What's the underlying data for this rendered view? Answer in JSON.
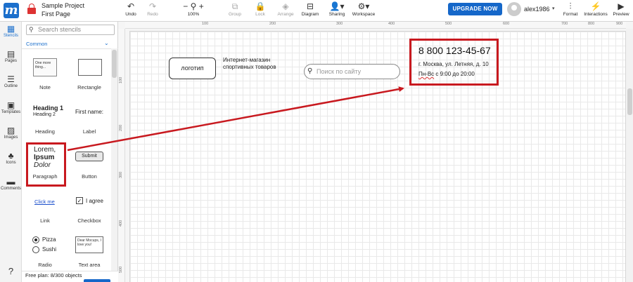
{
  "header": {
    "project_name": "Sample Project",
    "page_name": "First Page",
    "tools": [
      {
        "label": "Undo",
        "icon": "undo-icon"
      },
      {
        "label": "Redo",
        "icon": "redo-icon"
      },
      {
        "label": "100%",
        "icon": "zoom-icon"
      },
      {
        "label": "Group",
        "icon": "group-icon"
      },
      {
        "label": "Lock",
        "icon": "lock-icon"
      },
      {
        "label": "Arrange",
        "icon": "arrange-icon"
      },
      {
        "label": "Diagram",
        "icon": "diagram-icon"
      },
      {
        "label": "Sharing",
        "icon": "sharing-icon"
      },
      {
        "label": "Workspace",
        "icon": "workspace-icon"
      }
    ],
    "upgrade_label": "UPGRADE NOW",
    "username": "alex1986",
    "right_tools": [
      {
        "label": "Format",
        "icon": "format-icon"
      },
      {
        "label": "Interactions",
        "icon": "interactions-icon"
      },
      {
        "label": "Preview",
        "icon": "preview-icon"
      }
    ]
  },
  "rail": {
    "items": [
      {
        "label": "Stencils",
        "icon": "stencils-icon"
      },
      {
        "label": "Pages",
        "icon": "pages-icon"
      },
      {
        "label": "Outline",
        "icon": "outline-icon"
      },
      {
        "label": "Templates",
        "icon": "templates-icon"
      },
      {
        "label": "Images",
        "icon": "images-icon"
      },
      {
        "label": "Icons",
        "icon": "icons-icon"
      },
      {
        "label": "Comments",
        "icon": "comments-icon"
      }
    ],
    "help_icon": "help-icon"
  },
  "panel": {
    "search_placeholder": "Search stencils",
    "section": "Common",
    "tiles": [
      {
        "label": "Note",
        "preview": "One more thing..."
      },
      {
        "label": "Rectangle",
        "preview": ""
      },
      {
        "label": "Heading",
        "preview": "Heading 1",
        "preview2": "Heading 2"
      },
      {
        "label": "Label",
        "preview": "First name:"
      },
      {
        "label": "Paragraph",
        "preview": "Lorem,",
        "preview2": "Ipsum",
        "preview3": "Dolor"
      },
      {
        "label": "Button",
        "preview": "Submit"
      },
      {
        "label": "Link",
        "preview": "Click me"
      },
      {
        "label": "Checkbox",
        "preview": "I agree"
      },
      {
        "label": "Radio",
        "preview": "Pizza",
        "preview2": "Sushi"
      },
      {
        "label": "Text area",
        "preview": "Dear Mocups, I love you!"
      }
    ],
    "free_plan": "Free plan: 8/300 objects"
  },
  "canvas": {
    "h_ruler": [
      "100",
      "200",
      "300",
      "400",
      "500",
      "600",
      "700",
      "800",
      "900"
    ],
    "v_ruler": [
      "100",
      "200",
      "300",
      "400",
      "500",
      "600"
    ],
    "logo_text": "логотип",
    "shop_line1": "Интернет-магазин",
    "shop_line2": "спортивных товаров",
    "search_placeholder": "Поиск по сайту",
    "phone": "8 800 123-45-67",
    "address": "г. Москва, ул. Летняя, д. 10",
    "hours_prefix": "Пн-Вс",
    "hours_rest": " с 9:00 до 20:00"
  },
  "colors": {
    "accent": "#1567c9",
    "highlight": "#c8191f"
  }
}
